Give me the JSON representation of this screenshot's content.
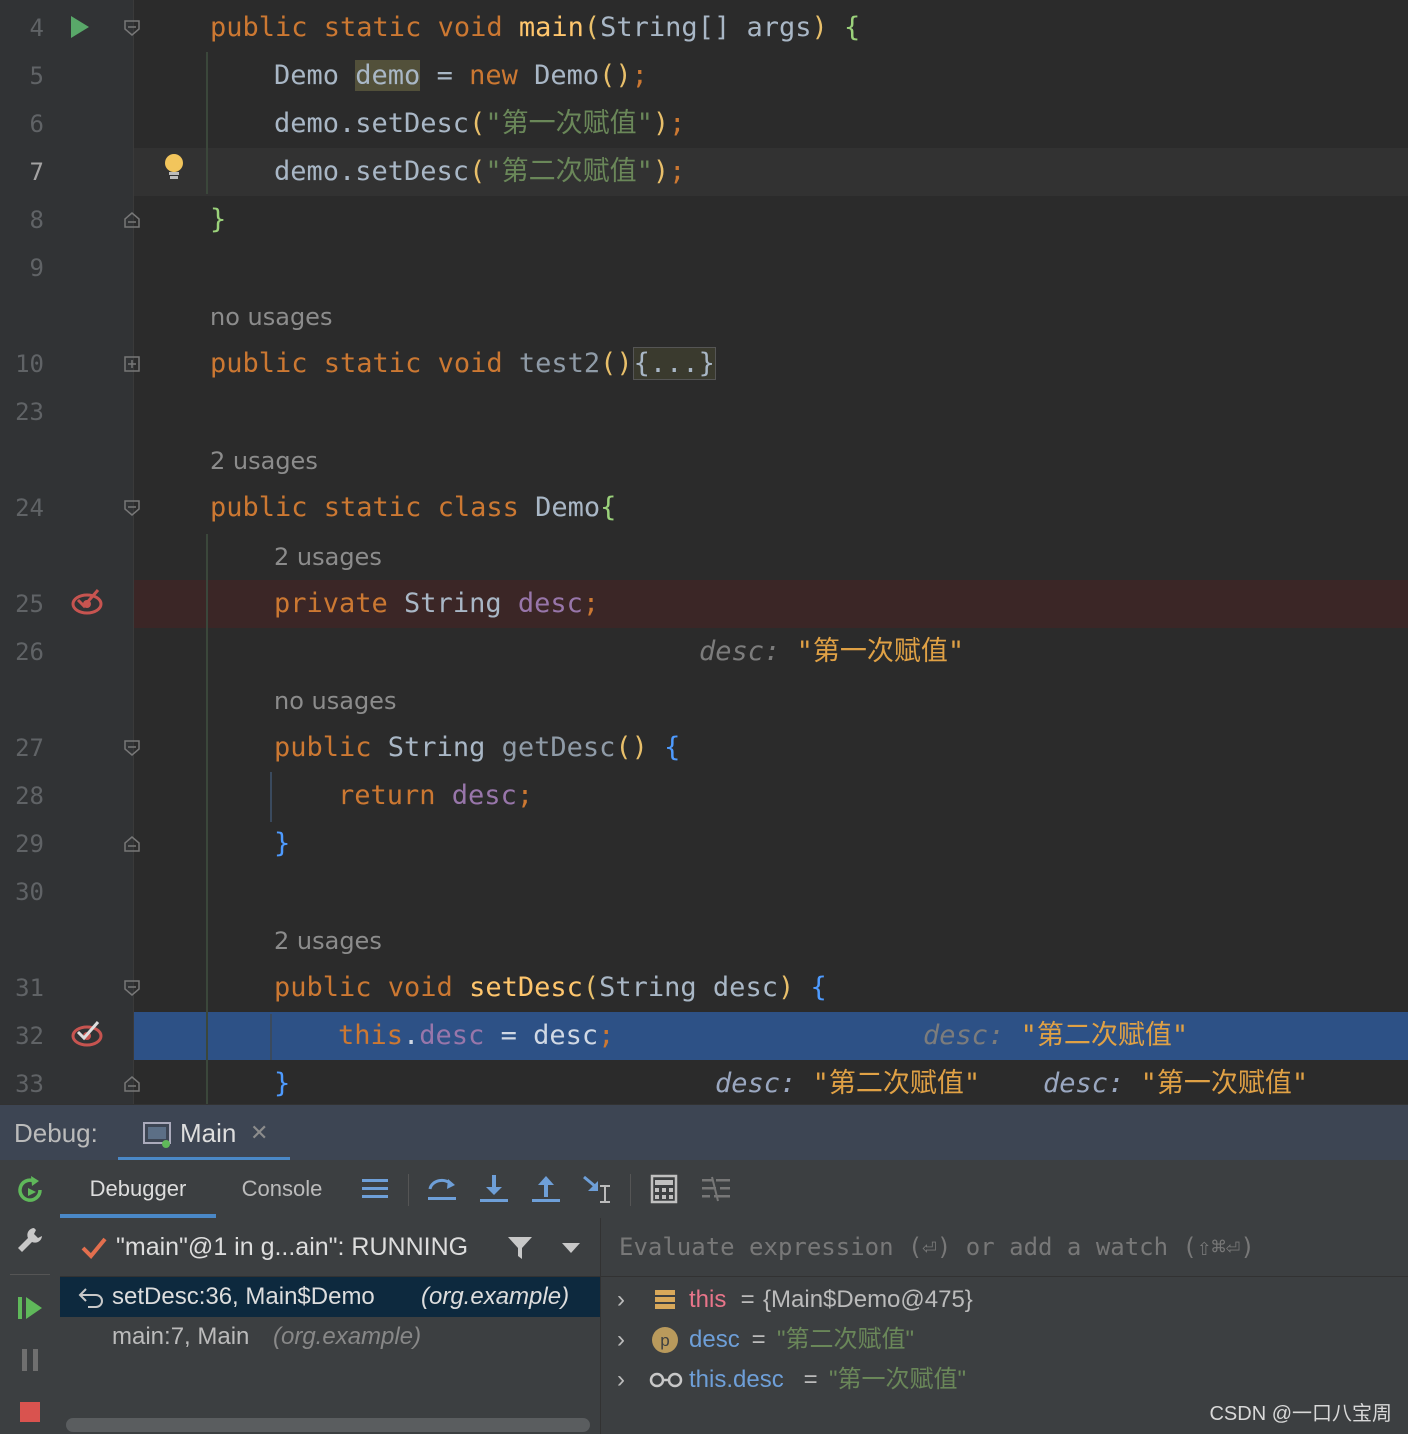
{
  "editor": {
    "lines": [
      {
        "num": "4",
        "tokens": [
          [
            "kw",
            "public static void "
          ],
          [
            "fn",
            "main"
          ],
          [
            "par-y",
            "("
          ],
          [
            "",
            "String[] args"
          ],
          [
            "par-y",
            ")"
          ],
          [
            "",
            ""
          ],
          [
            "par-g",
            " {"
          ]
        ]
      },
      {
        "num": "5",
        "tokens": [
          [
            "",
            "Demo "
          ],
          [
            "demo",
            "demo"
          ],
          [
            "",
            " = "
          ],
          [
            "kw",
            "new "
          ],
          [
            "",
            "Demo"
          ],
          [
            "par-y",
            "()"
          ],
          [
            "kw",
            ";"
          ]
        ]
      },
      {
        "num": "6",
        "tokens": [
          [
            "",
            "demo.setDesc"
          ],
          [
            "par-y",
            "("
          ],
          [
            "str",
            "\"第一次赋值\""
          ],
          [
            "par-y",
            ")"
          ],
          [
            "kw",
            ";"
          ]
        ]
      },
      {
        "num": "7",
        "tokens": [
          [
            "",
            "demo.setDesc"
          ],
          [
            "par-y",
            "("
          ],
          [
            "str",
            "\"第二次赋值\""
          ],
          [
            "par-y",
            ")"
          ],
          [
            "kw",
            ";"
          ]
        ]
      },
      {
        "num": "8",
        "tokens": [
          [
            "par-g",
            "}"
          ]
        ]
      },
      {
        "num": "9",
        "tokens": []
      },
      {
        "num": "10",
        "tokens": [
          [
            "kw",
            "public static void "
          ],
          [
            "dim",
            "test2"
          ],
          [
            "par-y",
            "()"
          ],
          [
            "fold",
            "{...}"
          ]
        ]
      },
      {
        "num": "23",
        "tokens": []
      },
      {
        "num": "24",
        "tokens": [
          [
            "kw",
            "public static class "
          ],
          [
            "",
            "Demo"
          ],
          [
            "par-g",
            "{"
          ]
        ]
      },
      {
        "num": "25",
        "tokens": [
          [
            "kw",
            "private "
          ],
          [
            "",
            "String "
          ],
          [
            "fld",
            "desc"
          ],
          [
            "kw",
            ";"
          ]
        ]
      },
      {
        "num": "26",
        "tokens": []
      },
      {
        "num": "27",
        "tokens": [
          [
            "kw",
            "public "
          ],
          [
            "",
            "String "
          ],
          [
            "dim",
            "getDesc"
          ],
          [
            "par-y",
            "() "
          ],
          [
            "par-b",
            "{"
          ]
        ]
      },
      {
        "num": "28",
        "tokens": [
          [
            "kw",
            "return "
          ],
          [
            "fld",
            "desc"
          ],
          [
            "kw",
            ";"
          ]
        ]
      },
      {
        "num": "29",
        "tokens": [
          [
            "par-b",
            "}"
          ]
        ]
      },
      {
        "num": "30",
        "tokens": []
      },
      {
        "num": "31",
        "tokens": [
          [
            "kw",
            "public void "
          ],
          [
            "fn",
            "setDesc"
          ],
          [
            "par-y",
            "("
          ],
          [
            "",
            "String desc"
          ],
          [
            "par-y",
            ") "
          ],
          [
            "par-b",
            "{"
          ]
        ]
      },
      {
        "num": "32",
        "tokens": [
          [
            "kw",
            "this"
          ],
          [
            "",
            "."
          ],
          [
            "fld",
            "desc"
          ],
          [
            "",
            " = desc"
          ],
          [
            "kw",
            ";"
          ]
        ]
      },
      {
        "num": "33",
        "tokens": [
          [
            "par-b",
            "}"
          ]
        ]
      }
    ],
    "hints": {
      "no_usages_1": "no usages",
      "two_usages_1": "2 usages",
      "two_usages_2": "2 usages",
      "no_usages_2": "no usages",
      "two_usages_3": "2 usages"
    },
    "inline_values": {
      "line25": {
        "label": "desc:",
        "value": "\"第一次赋值\""
      },
      "line31": {
        "label": "desc:",
        "value": "\"第二次赋值\""
      },
      "line32a": {
        "label": "desc:",
        "value": "\"第二次赋值\""
      },
      "line32b": {
        "label": "desc:",
        "value": "\"第一次赋值\""
      }
    },
    "colors": {
      "breakpoint_line": "#3b2626",
      "execution_line": "#2d5186",
      "caret_line": "#323232"
    }
  },
  "debug": {
    "label": "Debug:",
    "tab_main": "Main",
    "subtab_debugger": "Debugger",
    "subtab_console": "Console",
    "thread": "\"main\"@1 in g...ain\": RUNNING",
    "frames": [
      {
        "method": "setDesc:36, Main$Demo",
        "pkg": "(org.example)"
      },
      {
        "method": "main:7, Main",
        "pkg": "(org.example)"
      }
    ],
    "eval_placeholder": "Evaluate expression (⏎) or add a watch (⇧⌘⏎)",
    "variables": [
      {
        "name": "this",
        "eq": " = ",
        "value": "{Main$Demo@475}"
      },
      {
        "name": "desc",
        "eq": " = ",
        "value": "\"第二次赋值\""
      },
      {
        "name": "this.desc",
        "eq": " = ",
        "value": "\"第一次赋值\""
      }
    ]
  },
  "watermark": "CSDN @一口八宝周"
}
